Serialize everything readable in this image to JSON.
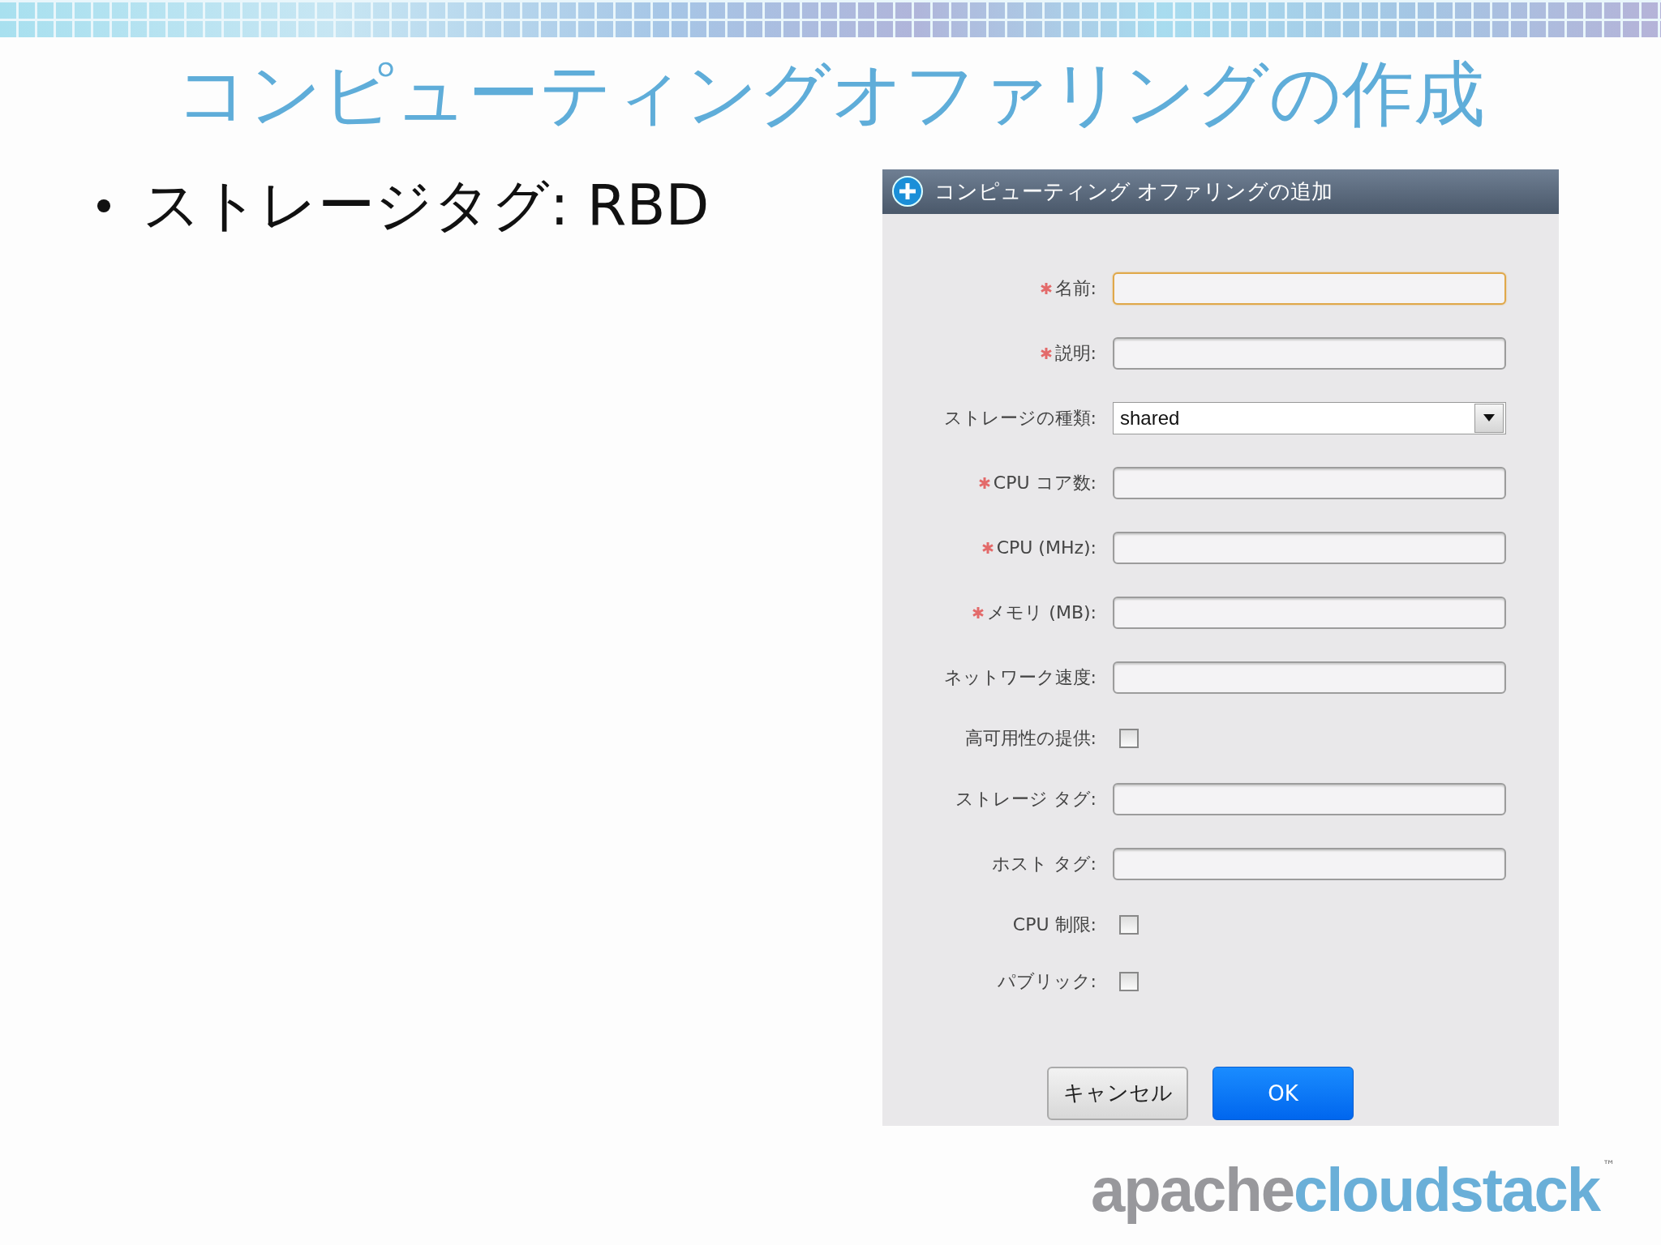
{
  "slide": {
    "title": "コンピューティングオファリングの作成",
    "bullets": [
      "ストレージタグ: RBD"
    ]
  },
  "dialog": {
    "title": "コンピューティング オファリングの追加",
    "fields": [
      {
        "kind": "text",
        "label": "名前:",
        "required": true,
        "focused": true
      },
      {
        "kind": "text",
        "label": "説明:",
        "required": true,
        "focused": false
      },
      {
        "kind": "select",
        "label": "ストレージの種類:",
        "required": false,
        "value": "shared"
      },
      {
        "kind": "text",
        "label": "CPU コア数:",
        "required": true,
        "focused": false
      },
      {
        "kind": "text",
        "label": "CPU (MHz):",
        "required": true,
        "focused": false
      },
      {
        "kind": "text",
        "label": "メモリ (MB):",
        "required": true,
        "focused": false
      },
      {
        "kind": "text",
        "label": "ネットワーク速度:",
        "required": false,
        "focused": false
      },
      {
        "kind": "checkbox",
        "label": "高可用性の提供:",
        "required": false,
        "checked": false
      },
      {
        "kind": "text",
        "label": "ストレージ タグ:",
        "required": false,
        "focused": false
      },
      {
        "kind": "text",
        "label": "ホスト タグ:",
        "required": false,
        "focused": false
      },
      {
        "kind": "checkbox",
        "label": "CPU 制限:",
        "required": false,
        "checked": false
      },
      {
        "kind": "checkbox",
        "label": "パブリック:",
        "required": false,
        "checked": false
      }
    ],
    "buttons": [
      {
        "kind": "secondary",
        "label": "キャンセル"
      },
      {
        "kind": "primary",
        "label": "OK"
      }
    ]
  },
  "logo": {
    "part_1": "apache",
    "part_2": "cloudstack",
    "trademark": "™"
  }
}
